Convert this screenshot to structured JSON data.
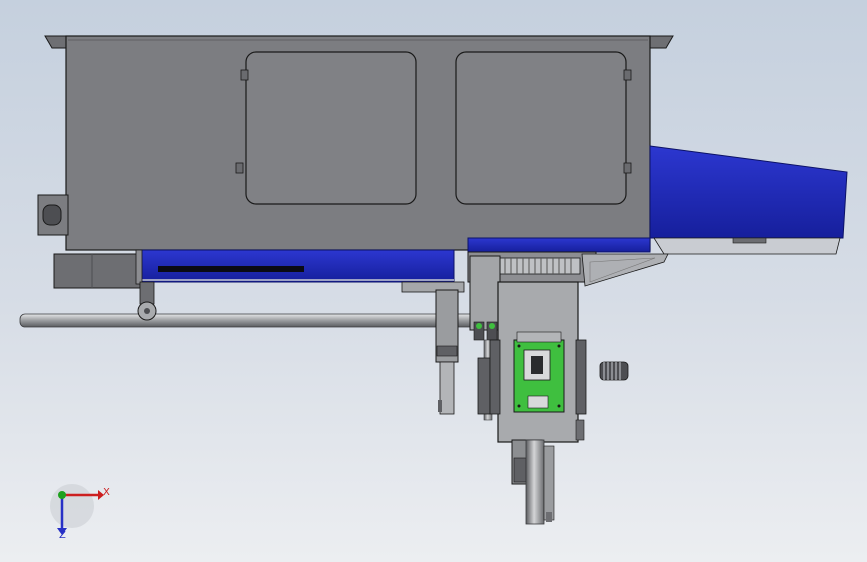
{
  "viewport": {
    "background_top": "#c5d0de",
    "background_bottom": "#eceef1"
  },
  "model": {
    "part_colors": {
      "housing": "#7c7d81",
      "housing_dark": "#5f6064",
      "conveyor": "#1f2bbf",
      "conveyor_dark": "#101880",
      "steel": "#a9abae",
      "pcb": "#3fbf3f",
      "outline": "#1a1a1a"
    }
  },
  "triad": {
    "x_label": "X",
    "z_label": "Z",
    "x_color": "#cc1f1f",
    "y_color": "#1ea11e",
    "z_color": "#2730c6"
  }
}
